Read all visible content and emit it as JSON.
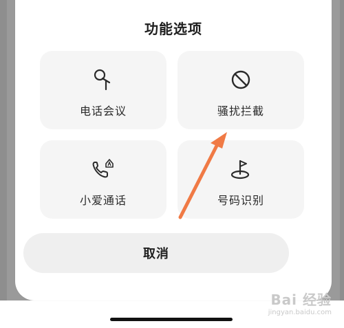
{
  "dialog": {
    "title": "功能选项",
    "cancel_label": "取消"
  },
  "tiles": [
    {
      "label": "电话会议",
      "icon": "microphone-icon"
    },
    {
      "label": "骚扰拦截",
      "icon": "block-icon"
    },
    {
      "label": "小爱通话",
      "icon": "ai-call-icon"
    },
    {
      "label": "号码识别",
      "icon": "flag-location-icon"
    }
  ],
  "watermark": {
    "logo": "Bai 经验",
    "url": "jingyan.baidu.com"
  },
  "colors": {
    "annotation_arrow": "#f07a45",
    "tile_background": "#f5f5f5",
    "sheet_background": "#ffffff"
  }
}
